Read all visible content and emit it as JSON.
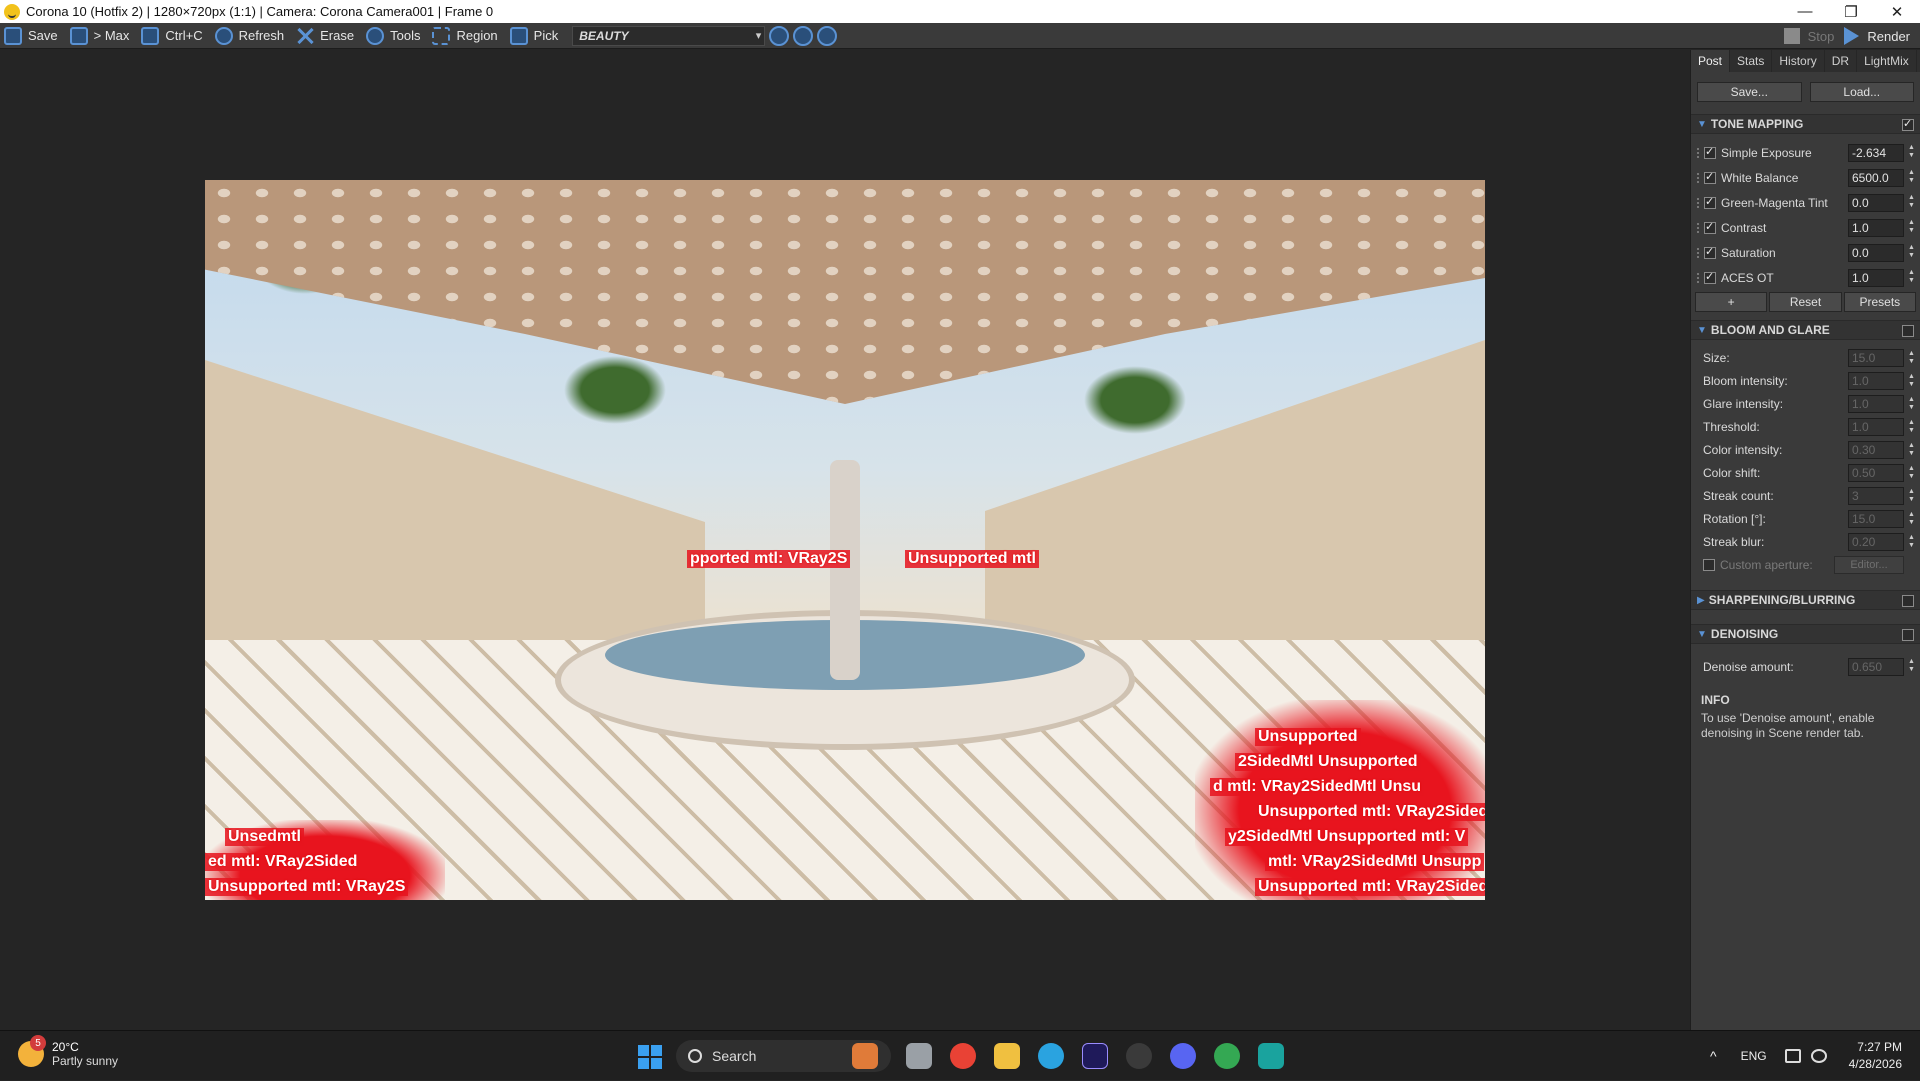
{
  "window": {
    "title": "Corona 10 (Hotfix 2) | 1280×720px (1:1) | Camera: Corona Camera001 | Frame 0",
    "minimize": "—",
    "maximize": "❐",
    "close": "✕"
  },
  "toolbar": {
    "save": "Save",
    "max": "> Max",
    "copy": "Ctrl+C",
    "refresh": "Refresh",
    "erase": "Erase",
    "tools": "Tools",
    "region": "Region",
    "pick": "Pick",
    "channel": "BEAUTY",
    "stop": "Stop",
    "render": "Render"
  },
  "render": {
    "error_texts": [
      "pported mtl: VRay2S",
      "Unsupported mtl",
      "Unsupported",
      "2SidedMtl   Unsupported",
      "d mtl: VRay2SidedMtl  Unsu",
      "Unsupported mtl: VRay2Sided",
      "y2SidedMtl   Unsupported mtl: V",
      "mtl: VRay2SidedMtl  Unsupp",
      "Unsupported mtl: VRay2Sided",
      "Unsedmtl",
      "ed mtl: VRay2Sided",
      "Unsupported mtl: VRay2S"
    ]
  },
  "panel": {
    "tabs": [
      "Post",
      "Stats",
      "History",
      "DR",
      "LightMix"
    ],
    "save_btn": "Save...",
    "load_btn": "Load...",
    "tone_mapping": {
      "title": "TONE MAPPING",
      "rows": [
        {
          "label": "Simple Exposure",
          "value": "-2.634"
        },
        {
          "label": "White Balance",
          "value": "6500.0"
        },
        {
          "label": "Green-Magenta Tint",
          "value": "0.0"
        },
        {
          "label": "Contrast",
          "value": "1.0"
        },
        {
          "label": "Saturation",
          "value": "0.0"
        },
        {
          "label": "ACES OT",
          "value": "1.0"
        }
      ],
      "add_btn": "+",
      "reset_btn": "Reset",
      "presets_btn": "Presets"
    },
    "bloom": {
      "title": "BLOOM AND GLARE",
      "rows": [
        {
          "label": "Size:",
          "value": "15.0"
        },
        {
          "label": "Bloom intensity:",
          "value": "1.0"
        },
        {
          "label": "Glare intensity:",
          "value": "1.0"
        },
        {
          "label": "Threshold:",
          "value": "1.0"
        },
        {
          "label": "Color intensity:",
          "value": "0.30"
        },
        {
          "label": "Color shift:",
          "value": "0.50"
        },
        {
          "label": "Streak count:",
          "value": "3"
        },
        {
          "label": "Rotation [°]:",
          "value": "15.0"
        },
        {
          "label": "Streak blur:",
          "value": "0.20"
        }
      ],
      "custom_aperture": "Custom aperture:",
      "editor_btn": "Editor..."
    },
    "sharpening": {
      "title": "SHARPENING/BLURRING"
    },
    "denoising": {
      "title": "DENOISING",
      "label": "Denoise amount:",
      "value": "0.650"
    },
    "info": {
      "title": "INFO",
      "text": "To use 'Denoise amount', enable denoising in Scene render tab."
    }
  },
  "taskbar": {
    "weather_badge": "5",
    "temp": "20°C",
    "condition": "Partly sunny",
    "search": "Search",
    "lang": "ENG",
    "time": "7:27 PM",
    "date": "4/28/2026"
  }
}
